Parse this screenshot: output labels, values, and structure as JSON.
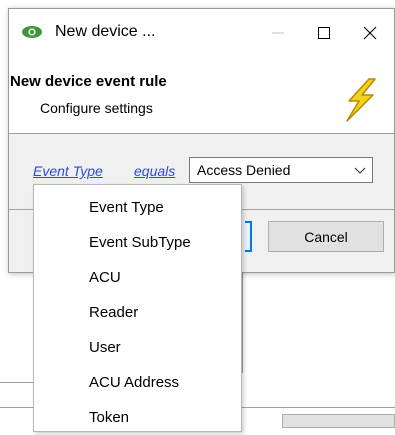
{
  "window": {
    "title": "New device ...",
    "app_icon": "eye-icon",
    "app_icon_color": "#3a9a3a",
    "controls": [
      "minimize-icon",
      "maximize-icon",
      "close-icon"
    ]
  },
  "header": {
    "title": "New device event rule",
    "subtitle": "Configure settings",
    "icon": "lightning-bolt-icon",
    "icon_color": "#f2d21b"
  },
  "rule": {
    "field_link": "Event Type",
    "operator_link": "equals",
    "value": "Access Denied",
    "link_color": "#2a4dd6"
  },
  "buttons": {
    "cancel": "Cancel"
  },
  "menu": {
    "items": [
      "Event Type",
      "Event SubType",
      "ACU",
      "Reader",
      "User",
      "ACU Address",
      "Token"
    ]
  }
}
